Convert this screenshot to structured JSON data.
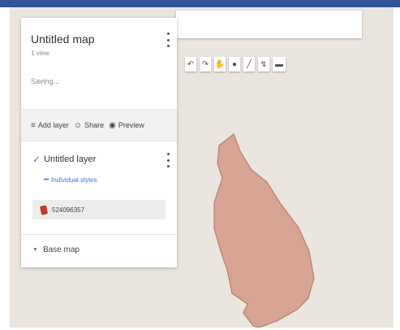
{
  "map": {
    "title": "Untitled map",
    "views": "1 view",
    "status": "Saving..."
  },
  "actions": {
    "add_layer": "Add layer",
    "share": "Share",
    "preview": "Preview"
  },
  "layer": {
    "title": "Untitled layer",
    "styles_link": "Individual styles",
    "feature_label": "524096357"
  },
  "basemap": {
    "label": "Base map"
  },
  "toolbar": {
    "tools": [
      "undo-icon",
      "redo-icon",
      "hand-icon",
      "marker-icon",
      "draw-line-icon",
      "route-icon",
      "ruler-icon"
    ]
  },
  "colors": {
    "polygon_fill": "#d7a493",
    "polygon_stroke": "#b97f6d",
    "map_background": "#eae6df",
    "link_blue": "#3d7ad9",
    "feature_pin": "#c0392b",
    "top_bar": "#2f5597"
  }
}
